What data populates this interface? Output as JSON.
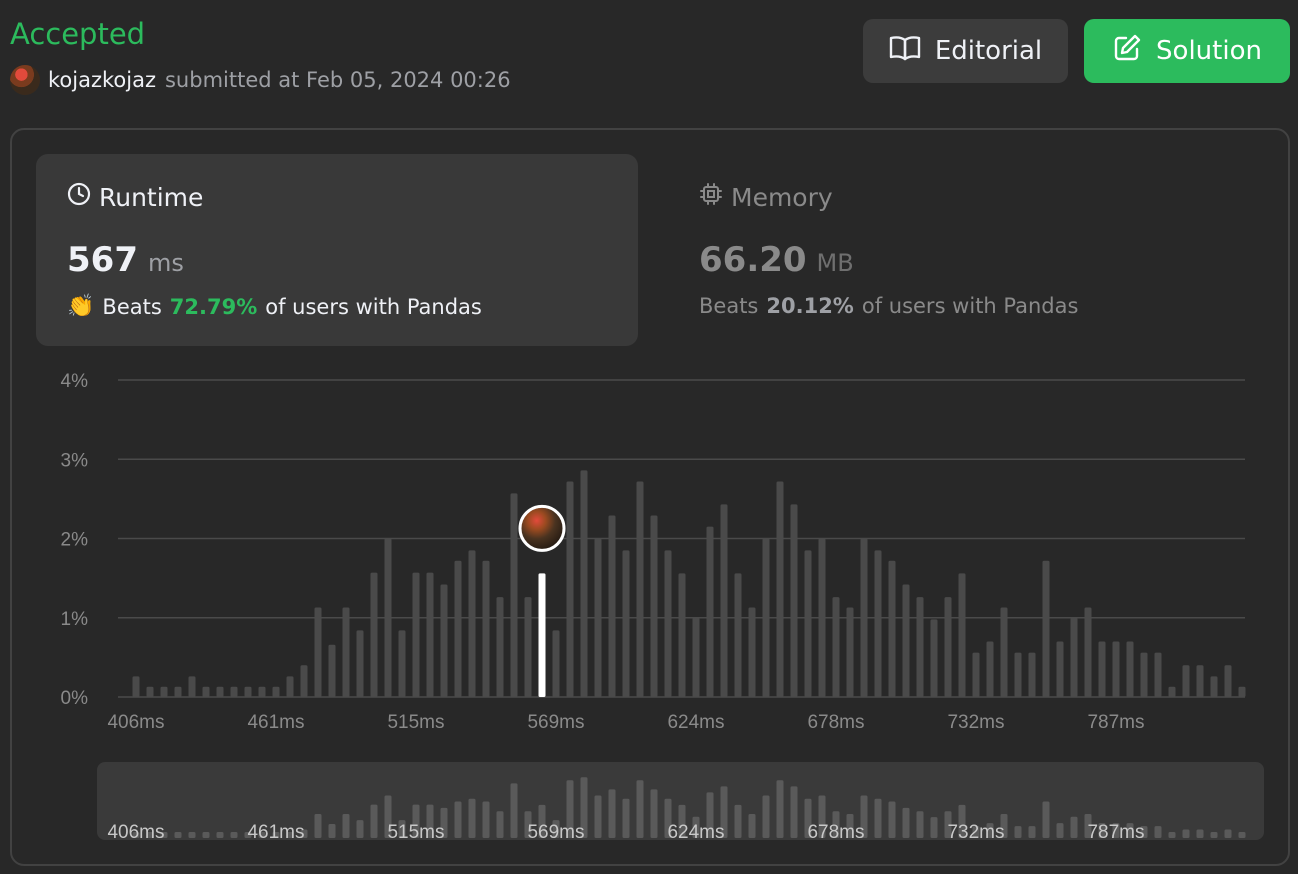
{
  "header": {
    "status": "Accepted",
    "username": "kojazkojaz",
    "submitted_text": "submitted at Feb 05, 2024 00:26"
  },
  "buttons": {
    "editorial": {
      "label": "Editorial",
      "icon": "book-icon"
    },
    "solution": {
      "label": "Solution",
      "icon": "edit-icon"
    }
  },
  "runtime": {
    "title": "Runtime",
    "icon": "clock-icon",
    "value": "567",
    "unit": "ms",
    "beats_label": "Beats",
    "beats_pct": "72.79%",
    "beats_suffix": "of users with Pandas"
  },
  "memory": {
    "title": "Memory",
    "icon": "chip-icon",
    "value": "66.20",
    "unit": "MB",
    "beats_label": "Beats",
    "beats_pct": "20.12%",
    "beats_suffix": "of users with Pandas"
  },
  "colors": {
    "accent_green": "#2cbb5d",
    "bar": "#4a4a4a",
    "highlight_bar": "#ffffff",
    "grid": "#4a4a4a"
  },
  "chart_data": {
    "type": "bar",
    "y_tick_labels": [
      "0%",
      "1%",
      "2%",
      "3%",
      "4%"
    ],
    "ylim": [
      0,
      4
    ],
    "x_tick_labels": [
      "406ms",
      "461ms",
      "515ms",
      "569ms",
      "624ms",
      "678ms",
      "732ms",
      "787ms"
    ],
    "x_tick_bar_index": [
      0,
      10,
      20,
      30,
      40,
      50,
      60,
      70
    ],
    "values": [
      0.26,
      0.13,
      0.13,
      0.13,
      0.26,
      0.13,
      0.13,
      0.13,
      0.13,
      0.13,
      0.13,
      0.26,
      0.4,
      1.13,
      0.66,
      1.13,
      0.84,
      1.57,
      2.0,
      0.84,
      1.57,
      1.57,
      1.42,
      1.72,
      1.85,
      1.72,
      1.26,
      2.57,
      1.26,
      1.56,
      0.84,
      2.72,
      2.86,
      2.0,
      2.29,
      1.85,
      2.72,
      2.29,
      1.85,
      1.56,
      1.0,
      2.15,
      2.43,
      1.56,
      1.13,
      2.0,
      2.72,
      2.43,
      1.85,
      2.0,
      1.26,
      1.13,
      2.0,
      1.85,
      1.72,
      1.42,
      1.26,
      0.98,
      1.26,
      1.56,
      0.56,
      0.7,
      1.13,
      0.56,
      0.56,
      1.72,
      0.7,
      1.0,
      1.13,
      0.7,
      0.7,
      0.7,
      0.56,
      0.56,
      0.13,
      0.4,
      0.4,
      0.26,
      0.4,
      0.13
    ],
    "highlight_index": 29,
    "grid": true
  }
}
